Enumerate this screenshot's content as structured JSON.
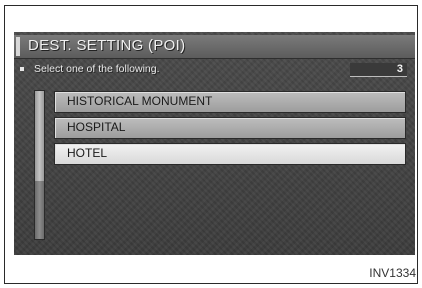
{
  "screen": {
    "title": "DEST. SETTING (POI)",
    "prompt": "Select one of the following.",
    "count": "3",
    "items": [
      {
        "label": "HISTORICAL MONUMENT",
        "selected": false
      },
      {
        "label": "HOSPITAL",
        "selected": false
      },
      {
        "label": "HOTEL",
        "selected": true
      }
    ]
  },
  "caption": "INV1334"
}
